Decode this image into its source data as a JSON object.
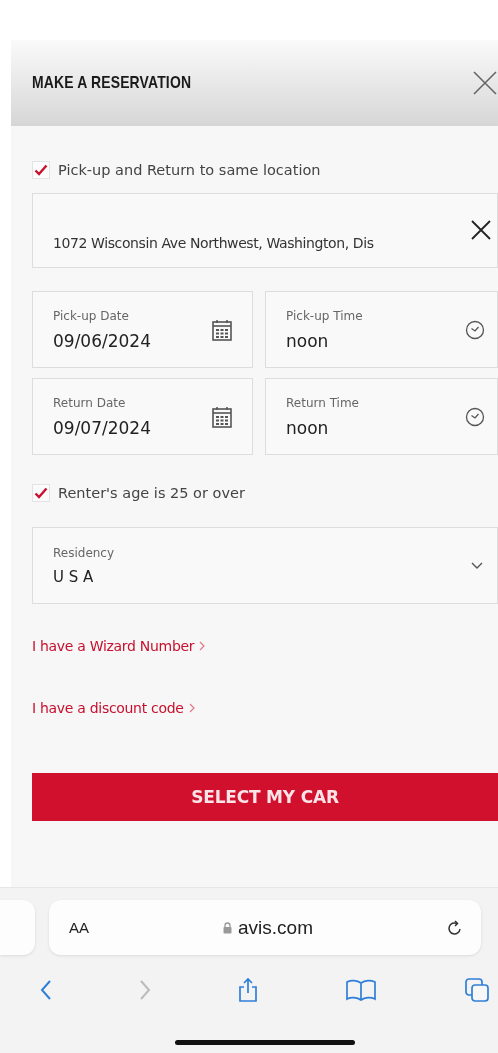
{
  "header": {
    "title": "MAKE A RESERVATION"
  },
  "same_location": {
    "label": "Pick-up and Return to same location",
    "checked": true
  },
  "location": {
    "value": "1072 Wisconsin Ave Northwest, Washington, Dis"
  },
  "date_fields": [
    {
      "kind": "date",
      "label": "Pick-up Date",
      "value": "09/06/2024"
    },
    {
      "kind": "time",
      "label": "Pick-up Time",
      "value": "noon"
    },
    {
      "kind": "date",
      "label": "Return Date",
      "value": "09/07/2024"
    },
    {
      "kind": "time",
      "label": "Return Time",
      "value": "noon"
    }
  ],
  "age": {
    "label": "Renter's age is 25 or over",
    "checked": true
  },
  "residency": {
    "label": "Residency",
    "value": "U S A"
  },
  "links": [
    "I have a Wizard Number",
    "I have a discount code"
  ],
  "submit": "SELECT MY CAR",
  "browser": {
    "text_size": "AA",
    "url": "avis.com"
  }
}
